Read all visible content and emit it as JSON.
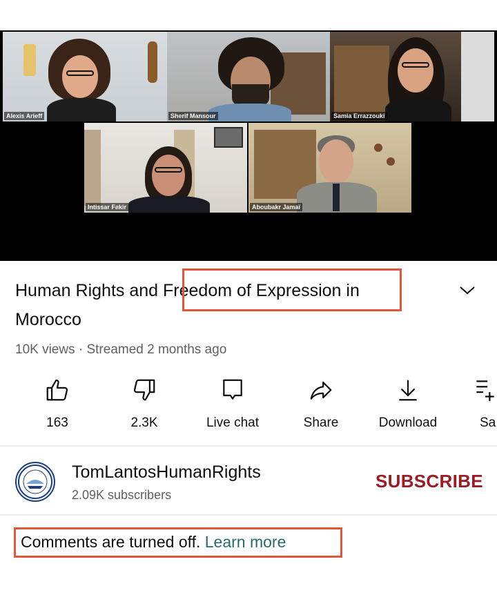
{
  "video": {
    "participants": [
      {
        "name": "Alexis Arieff",
        "active": true
      },
      {
        "name": "Sherif Mansour"
      },
      {
        "name": "Samia Errazzouki"
      },
      {
        "name": "Intissar Fakir"
      },
      {
        "name": "Aboubakr Jamaï"
      }
    ]
  },
  "title": {
    "part1": "Human Rights and ",
    "highlighted": "Freedom of Expression",
    "part2": " in",
    "line2": "Morocco"
  },
  "meta": "10K views · Streamed 2 months ago",
  "actions": [
    {
      "icon": "like-icon",
      "label": "163"
    },
    {
      "icon": "dislike-icon",
      "label": "2.3K"
    },
    {
      "icon": "live-chat-icon",
      "label": "Live chat"
    },
    {
      "icon": "share-icon",
      "label": "Share"
    },
    {
      "icon": "download-icon",
      "label": "Download"
    },
    {
      "icon": "save-icon",
      "label": "Sa"
    }
  ],
  "channel": {
    "name": "TomLantosHumanRights",
    "subscribers": "2.09K subscribers",
    "subscribe_label": "SUBSCRIBE"
  },
  "comments": {
    "text": "Comments are turned off. ",
    "link": "Learn more"
  },
  "colors": {
    "highlight_box": "#e2563a",
    "subscribe": "#9b1c24",
    "active_speaker": "#7ad23a"
  }
}
